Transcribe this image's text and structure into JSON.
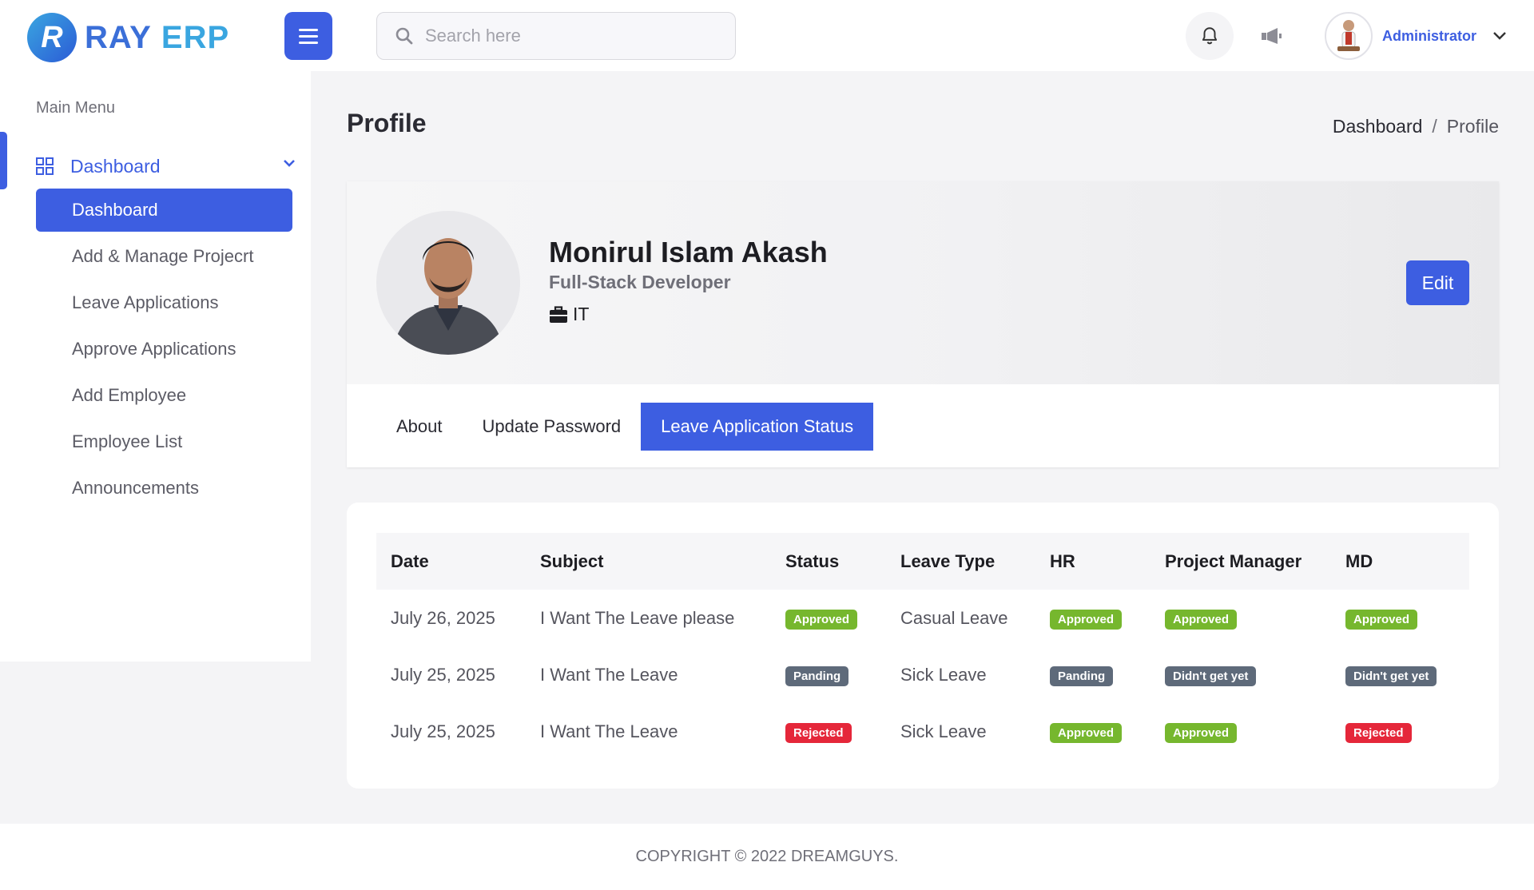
{
  "app": {
    "brand_first": "RAY",
    "brand_second": "ERP",
    "accent_color": "#3d5ee1"
  },
  "header": {
    "search_placeholder": "Search here",
    "user_name": "Administrator",
    "icons": [
      "hamburger-icon",
      "search-icon",
      "bell-icon",
      "megaphone-icon",
      "chevron-down-icon"
    ]
  },
  "sidebar": {
    "menu_title": "Main Menu",
    "main_item": "Dashboard",
    "items": [
      {
        "label": "Dashboard",
        "active": true
      },
      {
        "label": "Add & Manage Projecrt",
        "active": false
      },
      {
        "label": "Leave Applications",
        "active": false
      },
      {
        "label": "Approve Applications",
        "active": false
      },
      {
        "label": "Add Employee",
        "active": false
      },
      {
        "label": "Employee List",
        "active": false
      },
      {
        "label": "Announcements",
        "active": false
      }
    ]
  },
  "page": {
    "title": "Profile",
    "breadcrumb": {
      "home": "Dashboard",
      "separator": "/",
      "current": "Profile"
    }
  },
  "profile": {
    "name": "Monirul Islam Akash",
    "role": "Full-Stack Developer",
    "department": "IT",
    "edit_label": "Edit"
  },
  "tabs": [
    {
      "label": "About",
      "active": false
    },
    {
      "label": "Update Password",
      "active": false
    },
    {
      "label": "Leave Application Status",
      "active": true
    }
  ],
  "leave_table": {
    "columns": [
      "Date",
      "Subject",
      "Status",
      "Leave Type",
      "HR",
      "Project Manager",
      "MD"
    ],
    "rows": [
      {
        "date": "July 26, 2025",
        "subject": "I Want The Leave please",
        "status": {
          "text": "Approved",
          "kind": "approved"
        },
        "leave_type": "Casual Leave",
        "hr": {
          "text": "Approved",
          "kind": "approved"
        },
        "pm": {
          "text": "Approved",
          "kind": "approved"
        },
        "md": {
          "text": "Approved",
          "kind": "approved"
        }
      },
      {
        "date": "July 25, 2025",
        "subject": "I Want The Leave",
        "status": {
          "text": "Panding",
          "kind": "pending"
        },
        "leave_type": "Sick Leave",
        "hr": {
          "text": "Panding",
          "kind": "pending"
        },
        "pm": {
          "text": "Didn't get yet",
          "kind": "pending"
        },
        "md": {
          "text": "Didn't get yet",
          "kind": "pending"
        }
      },
      {
        "date": "July 25, 2025",
        "subject": "I Want The Leave",
        "status": {
          "text": "Rejected",
          "kind": "rejected"
        },
        "leave_type": "Sick Leave",
        "hr": {
          "text": "Approved",
          "kind": "approved"
        },
        "pm": {
          "text": "Approved",
          "kind": "approved"
        },
        "md": {
          "text": "Rejected",
          "kind": "rejected"
        }
      }
    ],
    "status_colors": {
      "approved": "#76b72e",
      "pending": "#5e6a7a",
      "rejected": "#e5273a"
    }
  },
  "footer": {
    "copyright": "COPYRIGHT © 2022 DREAMGUYS."
  }
}
